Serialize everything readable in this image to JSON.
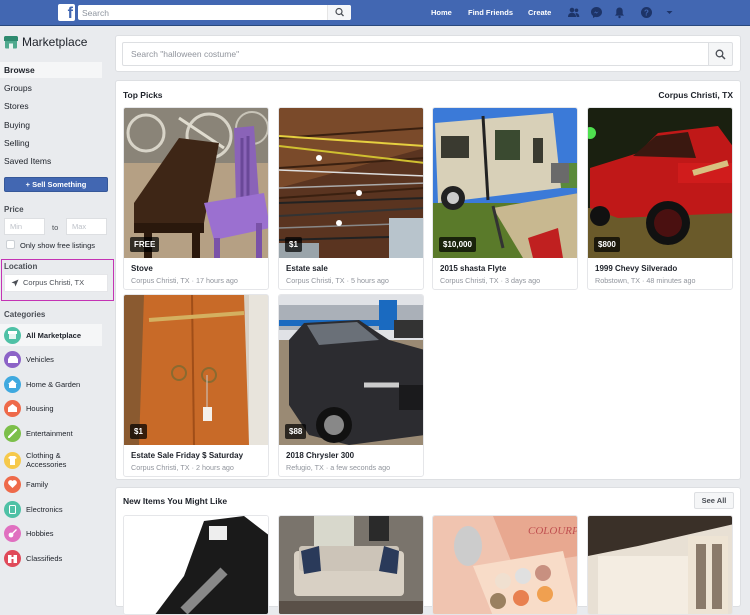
{
  "topbar": {
    "logo": "f",
    "search_placeholder": "Search",
    "nav": [
      "Home",
      "Find Friends",
      "Create"
    ],
    "icons": [
      "friends-icon",
      "messenger-icon",
      "notifications-icon",
      "help-icon",
      "account-menu-icon"
    ]
  },
  "sidebar": {
    "title": "Marketplace",
    "items": [
      {
        "label": "Browse",
        "active": true
      },
      {
        "label": "Groups"
      },
      {
        "label": "Stores"
      },
      {
        "label": "Buying"
      },
      {
        "label": "Selling"
      },
      {
        "label": "Saved Items"
      }
    ],
    "sell_button": "+ Sell Something",
    "price": {
      "label": "Price",
      "min_placeholder": "Min",
      "max_placeholder": "Max",
      "to": "to",
      "free_only_label": "Only show free listings",
      "free_only_checked": false
    },
    "location": {
      "label": "Location",
      "value": "Corpus Christi, TX"
    },
    "categories_label": "Categories",
    "categories": [
      {
        "label": "All Marketplace",
        "color": "#4fc1a6",
        "active": true
      },
      {
        "label": "Vehicles",
        "color": "#8c63c7"
      },
      {
        "label": "Home & Garden",
        "color": "#3fa9df"
      },
      {
        "label": "Housing",
        "color": "#ee6a4a"
      },
      {
        "label": "Entertainment",
        "color": "#7cbf4a"
      },
      {
        "label": "Clothing & Accessories",
        "label_line1": "Clothing &",
        "label_line2": "Accessories",
        "color": "#f6c94b"
      },
      {
        "label": "Family",
        "color": "#ee6a4a"
      },
      {
        "label": "Electronics",
        "color": "#4fc1a6"
      },
      {
        "label": "Hobbies",
        "color": "#e070c0"
      },
      {
        "label": "Classifieds",
        "color": "#e04a5a"
      }
    ]
  },
  "main": {
    "search_placeholder": "Search \"halloween costume\"",
    "top_picks": {
      "title": "Top Picks",
      "location": "Corpus Christi, TX",
      "items": [
        {
          "price": "FREE",
          "title": "Stove",
          "sub": "Corpus Christi, TX · 17 hours ago"
        },
        {
          "price": "$1",
          "title": "Estate sale",
          "sub": "Corpus Christi, TX · 5 hours ago"
        },
        {
          "price": "$10,000",
          "title": "2015 shasta Flyte",
          "sub": "Corpus Christi, TX · 3 days ago"
        },
        {
          "price": "$800",
          "title": "1999 Chevy Silverado",
          "sub": "Robstown, TX · 48 minutes ago"
        },
        {
          "price": "$1",
          "title": "Estate Sale Friday $ Saturday",
          "sub": "Corpus Christi, TX · 2 hours ago"
        },
        {
          "price": "$88",
          "title": "2018 Chrysler 300",
          "sub": "Refugio, TX · a few seconds ago"
        }
      ]
    },
    "new_items": {
      "title": "New Items You Might Like",
      "see_all": "See All"
    }
  },
  "colors": {
    "brand": "#4267b2",
    "highlight": "#c433b4"
  }
}
